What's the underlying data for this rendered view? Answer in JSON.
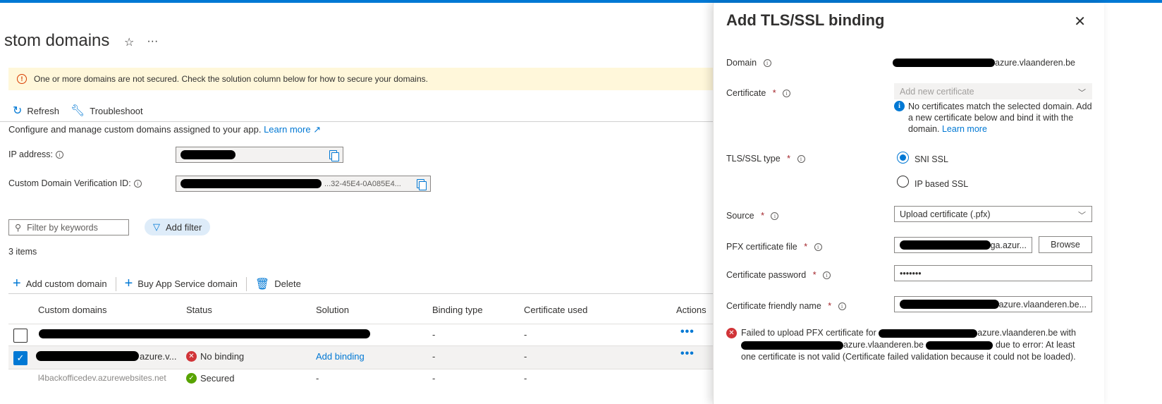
{
  "page": {
    "title": "stom domains",
    "star_icon": "☆",
    "more_icon": "···"
  },
  "banner": {
    "icon": "!",
    "text": "One or more domains are not secured. Check the solution column below for how to secure your domains."
  },
  "toolbar": {
    "refresh_label": "Refresh",
    "troubleshoot_label": "Troubleshoot"
  },
  "description": {
    "text": "Configure and manage custom domains assigned to your app.",
    "learn_more": "Learn more"
  },
  "fields": {
    "ip_label": "IP address:",
    "verification_label": "Custom Domain Verification ID:",
    "verification_suffix": "...32-45E4-0A085E4..."
  },
  "filter": {
    "placeholder": "Filter by keywords",
    "add_filter_label": "Add filter"
  },
  "items_count": "3 items",
  "commands": {
    "add_custom_domain": "Add custom domain",
    "buy_domain": "Buy App Service domain",
    "delete": "Delete"
  },
  "table": {
    "columns": [
      "Custom domains",
      "Status",
      "Solution",
      "Binding type",
      "Certificate used",
      "Actions"
    ],
    "rows": [
      {
        "domain": "",
        "status": "",
        "solution": "",
        "binding": "-",
        "cert": "-",
        "actions": "•••",
        "checked": false
      },
      {
        "domain": "azure.v...",
        "status": "No binding",
        "solution": "Add binding",
        "binding": "-",
        "cert": "-",
        "actions": "•••",
        "checked": true
      },
      {
        "domain": "l4backofficedev.azurewebsites.net",
        "status": "Secured",
        "solution": "-",
        "binding": "-",
        "cert": "-",
        "actions": "",
        "checked": false
      }
    ]
  },
  "panel": {
    "title": "Add TLS/SSL binding",
    "close_icon": "✕",
    "domain_label": "Domain",
    "domain_value": "azure.vlaanderen.be",
    "certificate_label": "Certificate",
    "certificate_value": "Add new certificate",
    "cert_info": "No certificates match the selected domain. Add a new certificate below and bind it with the domain.",
    "cert_info_link": "Learn more",
    "tls_type_label": "TLS/SSL type",
    "sni_label": "SNI SSL",
    "ip_based_label": "IP based SSL",
    "source_label": "Source",
    "source_value": "Upload certificate (.pfx)",
    "pfx_label": "PFX certificate file",
    "pfx_value": "ga.azur...",
    "browse_label": "Browse",
    "password_label": "Certificate password",
    "password_value": "•••••••",
    "friendly_label": "Certificate friendly name",
    "friendly_value": "azure.vlaanderen.be...",
    "required_mark": "*",
    "error_prefix": "Failed to upload PFX certificate for",
    "error_domain1": "azure.vlaanderen.be with",
    "error_domain2": "azure.vlaanderen.be",
    "error_rest": "due to error: At least one certificate is not valid (Certificate failed validation because it could not be loaded)."
  }
}
